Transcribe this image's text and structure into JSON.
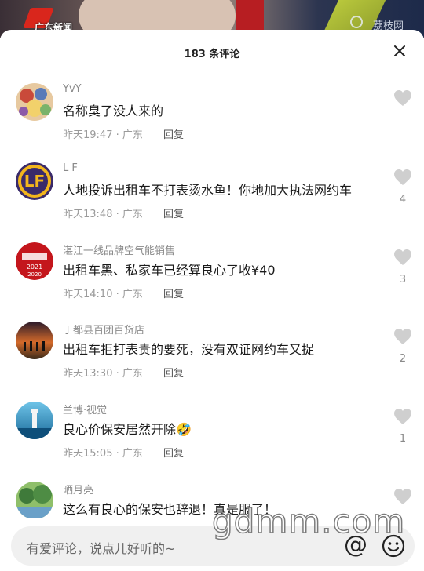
{
  "video": {
    "station_label": "广东新闻",
    "watermark": "荔枝网"
  },
  "header": {
    "title": "183 条评论"
  },
  "comments": [
    {
      "username": "YvY",
      "text": "名称臭了没人来的",
      "time": "昨天19:47",
      "location": "广东",
      "reply_label": "回复",
      "likes": ""
    },
    {
      "username": "L F",
      "text": "人地投诉出租车不打表烫水鱼！你地加大执法网约车",
      "time": "昨天13:48",
      "location": "广东",
      "reply_label": "回复",
      "likes": "4"
    },
    {
      "username": "湛江一线品牌空气能销售",
      "text": "出租车黑、私家车已经算良心了收¥40",
      "time": "昨天14:10",
      "location": "广东",
      "reply_label": "回复",
      "likes": "3"
    },
    {
      "username": "于都县百团百货店",
      "text": "出租车拒打表贵的要死，没有双证网约车又捉",
      "time": "昨天13:30",
      "location": "广东",
      "reply_label": "回复",
      "likes": "2"
    },
    {
      "username": "兰博·视觉",
      "text": "良心价保安居然开除🤣",
      "time": "昨天15:05",
      "location": "广东",
      "reply_label": "回复",
      "likes": "1"
    },
    {
      "username": "晒月亮",
      "text": "这么有良心的保安也辞退！真是服了！",
      "time": "",
      "location": "",
      "reply_label": "",
      "likes": ""
    }
  ],
  "input": {
    "placeholder": "有爱评论，说点儿好听的~",
    "at_symbol": "@"
  },
  "site_watermark": "gdmm.com",
  "colors": {
    "like_gray": "#c8c8c8",
    "text_primary": "#1a1a1a",
    "text_secondary": "#9a9a9a"
  }
}
